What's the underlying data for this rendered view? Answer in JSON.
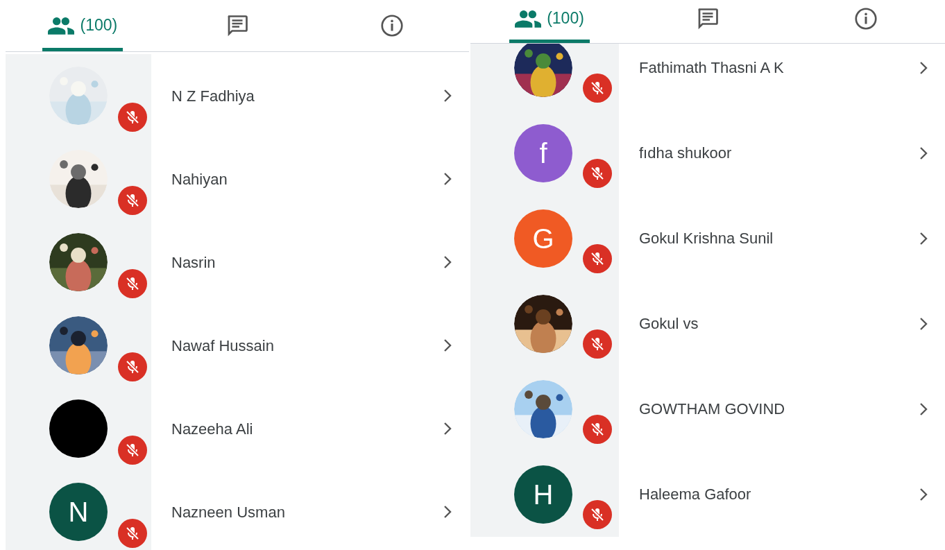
{
  "panels": [
    {
      "tabs": [
        {
          "kind": "people",
          "label": "(100)",
          "selected": true
        },
        {
          "kind": "chat",
          "selected": false
        },
        {
          "kind": "info",
          "selected": false
        }
      ],
      "participants": [
        {
          "name": "N Z Fadhiya",
          "muted": true
        },
        {
          "name": "Nahiyan",
          "muted": true
        },
        {
          "name": "Nasrin",
          "muted": true
        },
        {
          "name": "Nawaf Hussain",
          "muted": true
        },
        {
          "name": "Nazeeha Ali",
          "avatar": {
            "kind": "plain",
            "color": "#000000"
          },
          "muted": true
        },
        {
          "name": "Nazneen Usman",
          "avatar": {
            "kind": "letter",
            "letter": "N",
            "color": "#0b5345"
          },
          "muted": true
        }
      ]
    },
    {
      "tabs": [
        {
          "kind": "people",
          "label": "(100)",
          "selected": true
        },
        {
          "kind": "chat",
          "selected": false
        },
        {
          "kind": "info",
          "selected": false
        }
      ],
      "participants": [
        {
          "name": "Fathimath Thasni A K",
          "muted": true
        },
        {
          "name": "fıdha shukoor",
          "avatar": {
            "kind": "letter",
            "letter": "f",
            "color": "#8e5ccf"
          },
          "muted": true
        },
        {
          "name": "Gokul Krishna Sunil",
          "avatar": {
            "kind": "letter",
            "letter": "G",
            "color": "#f05a24"
          },
          "muted": true
        },
        {
          "name": "Gokul vs",
          "muted": true
        },
        {
          "name": "GOWTHAM GOVIND",
          "muted": true
        },
        {
          "name": "Haleema Gafoor",
          "avatar": {
            "kind": "letter",
            "letter": "H",
            "color": "#0b5345"
          },
          "muted": true
        }
      ]
    }
  ]
}
